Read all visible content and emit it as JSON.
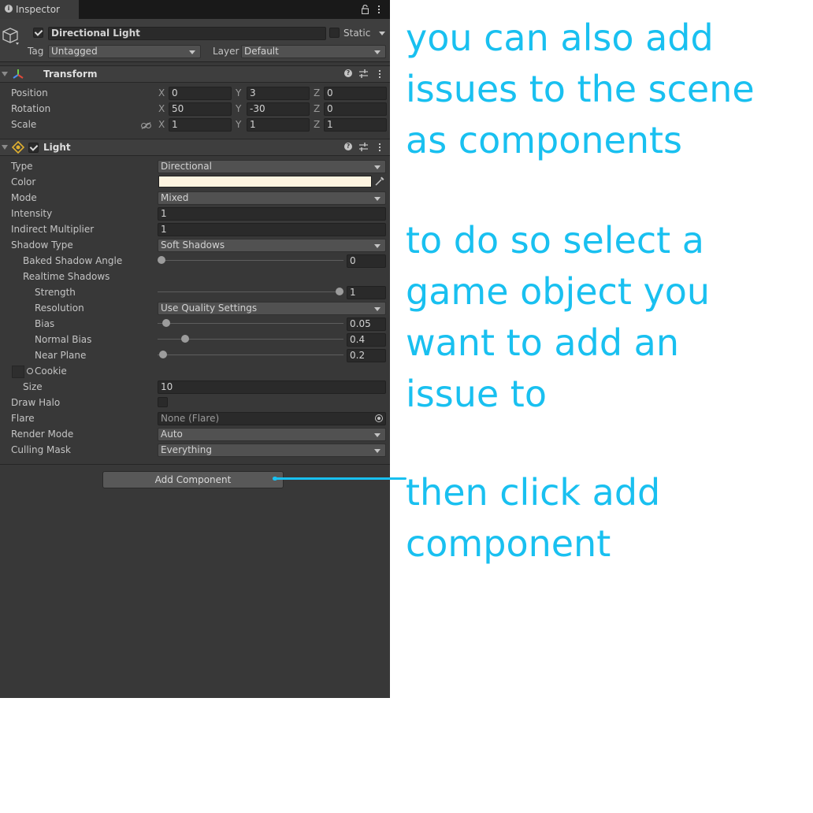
{
  "window": {
    "tab_title": "Inspector"
  },
  "object": {
    "name": "Directional Light",
    "static_label": "Static",
    "tag_label": "Tag",
    "tag_value": "Untagged",
    "layer_label": "Layer",
    "layer_value": "Default"
  },
  "transform": {
    "title": "Transform",
    "rows": [
      {
        "label": "Position",
        "x": "0",
        "y": "3",
        "z": "0"
      },
      {
        "label": "Rotation",
        "x": "50",
        "y": "-30",
        "z": "0"
      },
      {
        "label": "Scale",
        "x": "1",
        "y": "1",
        "z": "1"
      }
    ],
    "axis_x": "X",
    "axis_y": "Y",
    "axis_z": "Z"
  },
  "light": {
    "title": "Light",
    "type_label": "Type",
    "type_value": "Directional",
    "color_label": "Color",
    "color_value": "#fdf4e0",
    "mode_label": "Mode",
    "mode_value": "Mixed",
    "intensity_label": "Intensity",
    "intensity_value": "1",
    "indirect_label": "Indirect Multiplier",
    "indirect_value": "1",
    "shadow_type_label": "Shadow Type",
    "shadow_type_value": "Soft Shadows",
    "baked_angle_label": "Baked Shadow Angle",
    "baked_angle_value": "0",
    "realtime_label": "Realtime Shadows",
    "strength_label": "Strength",
    "strength_value": "1",
    "resolution_label": "Resolution",
    "resolution_value": "Use Quality Settings",
    "bias_label": "Bias",
    "bias_value": "0.05",
    "normal_bias_label": "Normal Bias",
    "normal_bias_value": "0.4",
    "near_plane_label": "Near Plane",
    "near_plane_value": "0.2",
    "cookie_label": "Cookie",
    "size_label": "Size",
    "size_value": "10",
    "draw_halo_label": "Draw Halo",
    "flare_label": "Flare",
    "flare_value": "None (Flare)",
    "render_mode_label": "Render Mode",
    "render_mode_value": "Auto",
    "culling_label": "Culling Mask",
    "culling_value": "Everything"
  },
  "add_component_label": "Add Component",
  "annotations": {
    "line1": "you can also add",
    "line2": "issues to the scene",
    "line3": "as components",
    "line4": "to do so select a",
    "line5": "game object you",
    "line6": "want to add an",
    "line7": "issue to",
    "line8": "then click add",
    "line9": "component"
  },
  "colors": {
    "annotation": "#19c0f0",
    "panel": "#383838"
  }
}
